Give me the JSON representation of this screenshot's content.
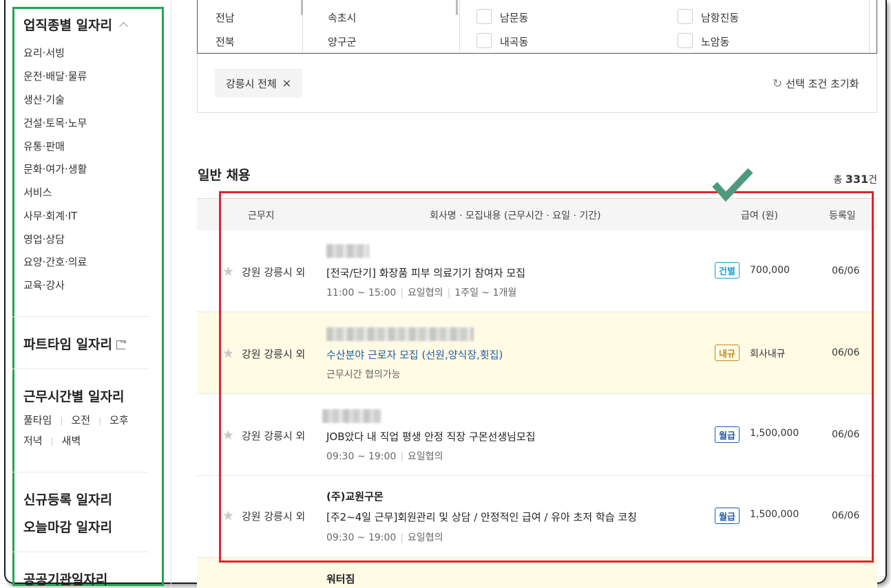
{
  "sidebar": {
    "occupation_title": "업직종별 일자리",
    "occupations": [
      "요리·서빙",
      "운전·배달·물류",
      "생산·기술",
      "건설·토목·노무",
      "유통·판매",
      "문화·여가·생활",
      "서비스",
      "사무·회계·IT",
      "영업·상담",
      "요양·간호·의료",
      "교육·강사"
    ],
    "parttime_title": "파트타임 일자리",
    "worktime_title": "근무시간별 일자리",
    "worktimes": [
      "풀타임",
      "오전",
      "오후",
      "저녁",
      "새벽"
    ],
    "new_title": "신규등록 일자리",
    "closing_title": "오늘마감 일자리",
    "public_title": "공공기관일자리"
  },
  "region": {
    "provinces": [
      "전남",
      "전북"
    ],
    "cities": [
      "속초시",
      "양구군"
    ],
    "dongs_left": [
      "남문동",
      "내곡동"
    ],
    "dongs_right": [
      "남항진동",
      "노암동"
    ]
  },
  "filter": {
    "chip_label": "강릉시 전체",
    "reset_label": "선택 조건 초기화"
  },
  "list": {
    "title": "일반 채용",
    "total_prefix": "총",
    "total_count": "331",
    "total_suffix": "건",
    "headers": {
      "location": "근무지",
      "content": "회사명 · 모집내용 (근무시간 · 요일 · 기간)",
      "pay": "급여 (원)",
      "date": "등록일"
    },
    "rows": [
      {
        "location": "강원 강릉시 외",
        "title": "[전국/단기] 화장품 피부 의료기기 참여자 모집",
        "meta1": "11:00 ~ 15:00",
        "meta2": "요일협의",
        "meta3": "1주일 ~ 1개월",
        "badge": "건별",
        "pay": "700,000",
        "date": "06/06"
      },
      {
        "location": "강원 강릉시 외",
        "title": "수산분야 근로자 모집 (선원,양식장,횟집)",
        "meta1": "근무시간 협의가능",
        "badge": "내규",
        "pay": "회사내규",
        "date": "06/06"
      },
      {
        "location": "강원 강릉시 외",
        "title": "JOB았다 내 직업 평생 안정 직장 구몬선생님모집",
        "meta1": "09:30 ~ 19:00",
        "meta2": "요일협의",
        "badge": "월급",
        "pay": "1,500,000",
        "date": "06/06"
      },
      {
        "location": "강원 강릉시 외",
        "company": "(주)교원구몬",
        "title": "[주2~4일 근무]회원관리 및 상담 / 안정적인 급여 / 유아 초저 학습 코칭",
        "meta1": "09:30 ~ 19:00",
        "meta2": "요일협의",
        "badge": "월급",
        "pay": "1,500,000",
        "date": "06/06"
      },
      {
        "company": "워터짐"
      }
    ]
  },
  "colors": {
    "sidebar_outline": "#23a455",
    "list_outline": "#e0232d",
    "checkmark": "#4e9a7e"
  }
}
